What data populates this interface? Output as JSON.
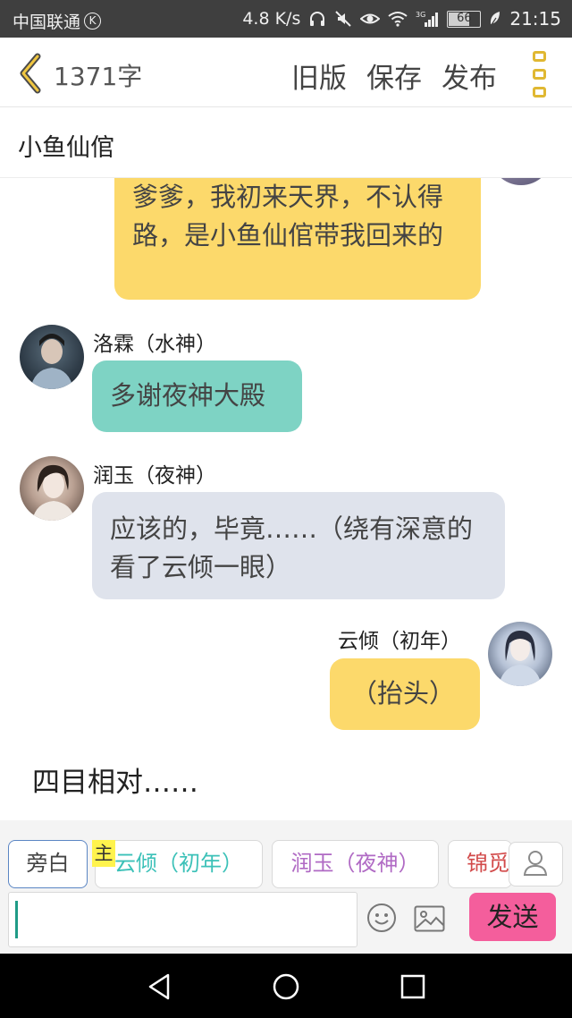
{
  "status_bar": {
    "carrier": "中国联通",
    "carrier_badge": "K",
    "speed": "4.8 K/s",
    "network": "3G",
    "battery": "66",
    "battery_level": 0.66,
    "time": "21:15"
  },
  "header": {
    "word_count": "1371字",
    "old_version_label": "旧版",
    "save_label": "保存",
    "publish_label": "发布",
    "accent_color": "#e0b832"
  },
  "story": {
    "title": "小鱼仙倌"
  },
  "messages": [
    {
      "speaker": "",
      "text": "爹爹，我初来天界，不认得路，是小鱼仙倌带我回来的",
      "color": "#fcd96b",
      "side": "right"
    },
    {
      "speaker": "洛霖（水神）",
      "text": "多谢夜神大殿",
      "color": "#7ed3c4",
      "side": "left"
    },
    {
      "speaker": "润玉（夜神）",
      "text": "应该的，毕竟……（绕有深意的看了云倾一眼）",
      "color": "#dfe3ec",
      "side": "left"
    },
    {
      "speaker": "云倾（初年）",
      "text": "（抬头）",
      "color": "#fcd96b",
      "side": "right"
    }
  ],
  "narration": "四目相对……",
  "roles": {
    "narrator_label": "旁白",
    "main_tag": "主",
    "items": [
      "云倾（初年）",
      "润玉（夜神）",
      "锦觅"
    ],
    "colors": [
      "#3cc1b8",
      "#b06ac4",
      "#d24a4a"
    ]
  },
  "composer": {
    "value": "",
    "send_label": "发送",
    "send_color": "#f45e9c"
  }
}
